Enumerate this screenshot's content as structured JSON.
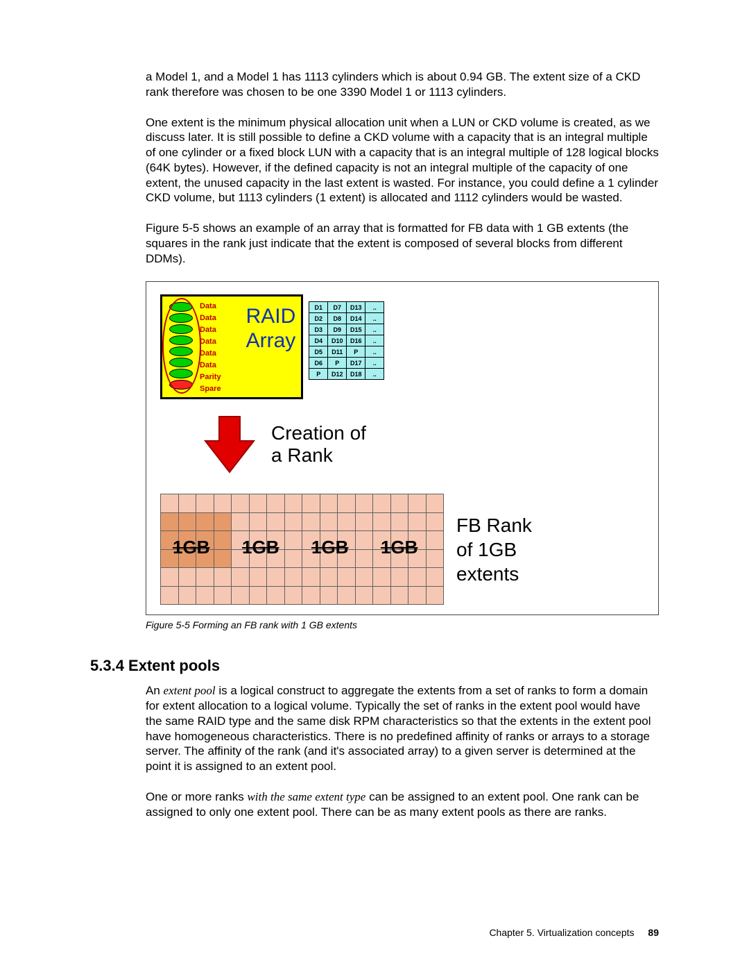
{
  "para1": "a Model 1, and a Model 1 has 1113 cylinders which is about 0.94 GB. The extent size of a CKD rank therefore was chosen to be one 3390 Model 1 or 1113 cylinders.",
  "para2": "One extent is the minimum physical allocation unit when a LUN or CKD volume is created, as we discuss later. It is still possible to define a CKD volume with a capacity that is an integral multiple of one cylinder or a fixed block LUN with a capacity that is an integral multiple of 128 logical blocks (64K bytes). However, if the defined capacity is not an integral multiple of the capacity of one extent, the unused capacity in the last extent is wasted. For instance, you could define a 1 cylinder CKD volume, but 1113 cylinders (1 extent) is allocated and 1112 cylinders would be wasted.",
  "para3": "Figure 5-5 shows an example of an array that is formatted for FB data with 1 GB extents (the squares in the rank just indicate that the extent is composed of several blocks from different DDMs).",
  "disk_labels": [
    "Data",
    "Data",
    "Data",
    "Data",
    "Data",
    "Data",
    "Parity",
    "Spare"
  ],
  "raid_title_l1": "RAID",
  "raid_title_l2": "Array",
  "d_grid": [
    [
      "D1",
      "D7",
      "D13",
      ".."
    ],
    [
      "D2",
      "D8",
      "D14",
      ".."
    ],
    [
      "D3",
      "D9",
      "D15",
      ".."
    ],
    [
      "D4",
      "D10",
      "D16",
      ".."
    ],
    [
      "D5",
      "D11",
      "P",
      ".."
    ],
    [
      "D6",
      "P",
      "D17",
      ".."
    ],
    [
      "P",
      "D12",
      "D18",
      ".."
    ]
  ],
  "creation_l1": "Creation of",
  "creation_l2": "a Rank",
  "gb": "1GB",
  "fb_l1": "FB Rank",
  "fb_l2": "of 1GB",
  "fb_l3": "extents",
  "caption": "Figure 5-5   Forming an FB rank with 1 GB extents",
  "section": "5.3.4  Extent pools",
  "p_pool_pre": "An ",
  "p_pool_it": "extent pool",
  "p_pool_post": " is a logical construct to aggregate the extents from a set of ranks to form a domain for extent allocation to a logical volume. Typically the set of ranks in the extent pool would have the same RAID type and the same disk RPM characteristics so that the extents in the extent pool have homogeneous characteristics. There is no predefined affinity of ranks or arrays to a storage server. The affinity of the rank (and it's associated array) to a given server is determined at the point it is assigned to an extent pool.",
  "p_ranks_pre": "One or more ranks ",
  "p_ranks_it": "with the same extent type",
  "p_ranks_post": " can be assigned to an extent pool. One rank can be assigned to only one extent pool. There can be as many extent pools as there are ranks.",
  "footer_chapter": "Chapter 5. Virtualization concepts",
  "footer_page": "89"
}
